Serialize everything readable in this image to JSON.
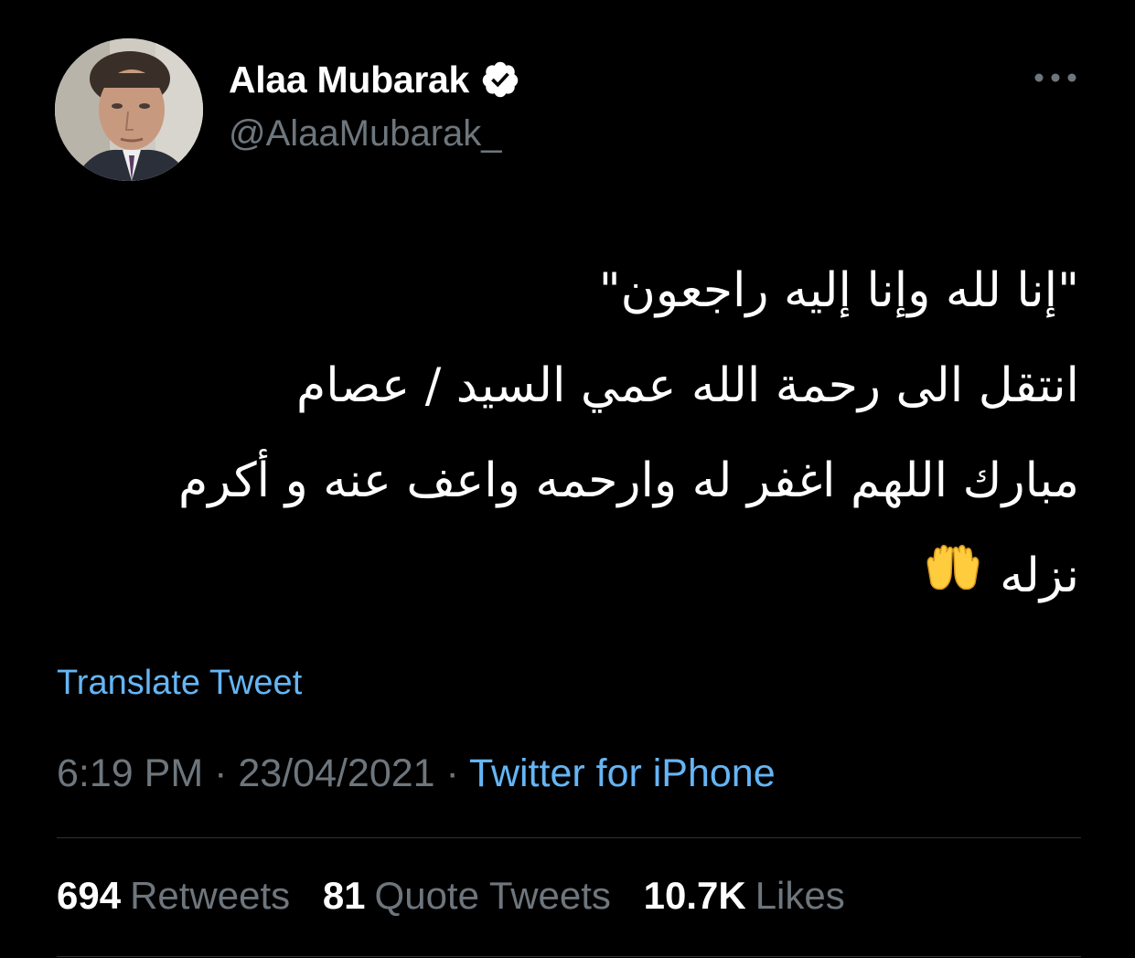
{
  "author": {
    "display_name": "Alaa Mubarak",
    "handle": "@AlaaMubarak_",
    "verified": true,
    "avatar_icon": "profile-photo"
  },
  "tweet": {
    "lines": [
      "\"إنا لله وإنا إليه راجعون\"",
      "انتقل الى رحمة الله عمي السيد / عصام",
      "مبارك اللهم اغفر له وارحمه واعف عنه و أكرم",
      "نزله"
    ],
    "emoji_icon": "raising-hands-emoji",
    "translate_label": "Translate Tweet"
  },
  "meta": {
    "time": "6:19 PM",
    "separator": "·",
    "date": "23/04/2021",
    "source": "Twitter for iPhone"
  },
  "stats": {
    "retweets_count": "694",
    "retweets_label": "Retweets",
    "quotes_count": "81",
    "quotes_label": "Quote Tweets",
    "likes_count": "10.7K",
    "likes_label": "Likes"
  },
  "colors": {
    "background": "#000000",
    "text": "#ffffff",
    "secondary": "#6e767d",
    "link": "#65b5f5",
    "divider": "#2f3336"
  },
  "icons": {
    "more": "more-horizontal-icon",
    "verified": "verified-badge-icon"
  }
}
